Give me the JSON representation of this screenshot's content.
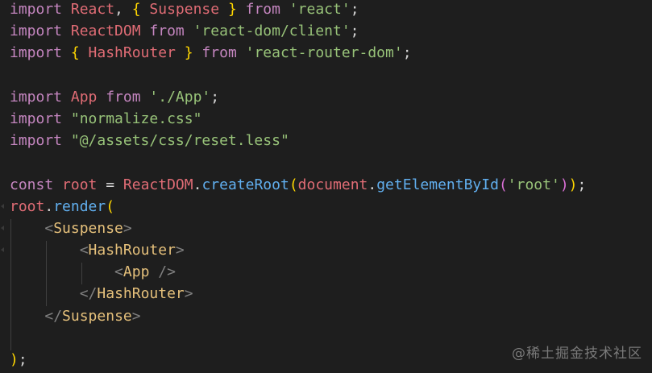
{
  "colors": {
    "background": "#1e1e1e",
    "keyword": "#c586c0",
    "identifier": "#e06c75",
    "string": "#98c379",
    "function": "#61afef",
    "brace": "#ffd700",
    "paren2": "#da70d6",
    "punct": "#d4d4d4",
    "tag_bracket": "#808080",
    "jsx_tag": "#e5c07b"
  },
  "code_lines": [
    [
      [
        "import ",
        "keyword"
      ],
      [
        "React",
        "identifier"
      ],
      [
        ", ",
        "punct"
      ],
      [
        "{",
        "brace"
      ],
      [
        " Suspense ",
        "identifier"
      ],
      [
        "}",
        "brace"
      ],
      [
        " from ",
        "keyword"
      ],
      [
        "'react'",
        "string"
      ],
      [
        ";",
        "punct"
      ]
    ],
    [
      [
        "import ",
        "keyword"
      ],
      [
        "ReactDOM ",
        "identifier"
      ],
      [
        "from ",
        "keyword"
      ],
      [
        "'react-dom/client'",
        "string"
      ],
      [
        ";",
        "punct"
      ]
    ],
    [
      [
        "import ",
        "keyword"
      ],
      [
        "{",
        "brace"
      ],
      [
        " HashRouter ",
        "identifier"
      ],
      [
        "}",
        "brace"
      ],
      [
        " from ",
        "keyword"
      ],
      [
        "'react-router-dom'",
        "string"
      ],
      [
        ";",
        "punct"
      ]
    ],
    [],
    [
      [
        "import ",
        "keyword"
      ],
      [
        "App ",
        "identifier"
      ],
      [
        "from ",
        "keyword"
      ],
      [
        "'./App'",
        "string"
      ],
      [
        ";",
        "punct"
      ]
    ],
    [
      [
        "import ",
        "keyword"
      ],
      [
        "\"normalize.css\"",
        "string"
      ]
    ],
    [
      [
        "import ",
        "keyword"
      ],
      [
        "\"@/assets/css/reset.less\"",
        "string"
      ]
    ],
    [],
    [
      [
        "const ",
        "keyword"
      ],
      [
        "root ",
        "identifier"
      ],
      [
        "= ",
        "punct"
      ],
      [
        "ReactDOM",
        "identifier"
      ],
      [
        ".",
        "punct"
      ],
      [
        "createRoot",
        "function"
      ],
      [
        "(",
        "brace"
      ],
      [
        "document",
        "identifier"
      ],
      [
        ".",
        "punct"
      ],
      [
        "getElementById",
        "function"
      ],
      [
        "(",
        "paren2"
      ],
      [
        "'root'",
        "string"
      ],
      [
        ")",
        "paren2"
      ],
      [
        ")",
        "brace"
      ],
      [
        ";",
        "punct"
      ]
    ],
    [
      [
        "root",
        "identifier"
      ],
      [
        ".",
        "punct"
      ],
      [
        "render",
        "function"
      ],
      [
        "(",
        "brace"
      ]
    ],
    [
      [
        "    ",
        "punct"
      ],
      [
        "<",
        "tag_bracket"
      ],
      [
        "Suspense",
        "jsx_tag"
      ],
      [
        ">",
        "tag_bracket"
      ]
    ],
    [
      [
        "        ",
        "punct"
      ],
      [
        "<",
        "tag_bracket"
      ],
      [
        "HashRouter",
        "jsx_tag"
      ],
      [
        ">",
        "tag_bracket"
      ]
    ],
    [
      [
        "            ",
        "punct"
      ],
      [
        "<",
        "tag_bracket"
      ],
      [
        "App ",
        "jsx_tag"
      ],
      [
        "/>",
        "tag_bracket"
      ]
    ],
    [
      [
        "        ",
        "punct"
      ],
      [
        "</",
        "tag_bracket"
      ],
      [
        "HashRouter",
        "jsx_tag"
      ],
      [
        ">",
        "tag_bracket"
      ]
    ],
    [
      [
        "    ",
        "punct"
      ],
      [
        "</",
        "tag_bracket"
      ],
      [
        "Suspense",
        "jsx_tag"
      ],
      [
        ">",
        "tag_bracket"
      ]
    ],
    [],
    [
      [
        ")",
        "brace"
      ],
      [
        ";",
        "punct"
      ]
    ]
  ],
  "watermark": "@稀土掘金技术社区"
}
